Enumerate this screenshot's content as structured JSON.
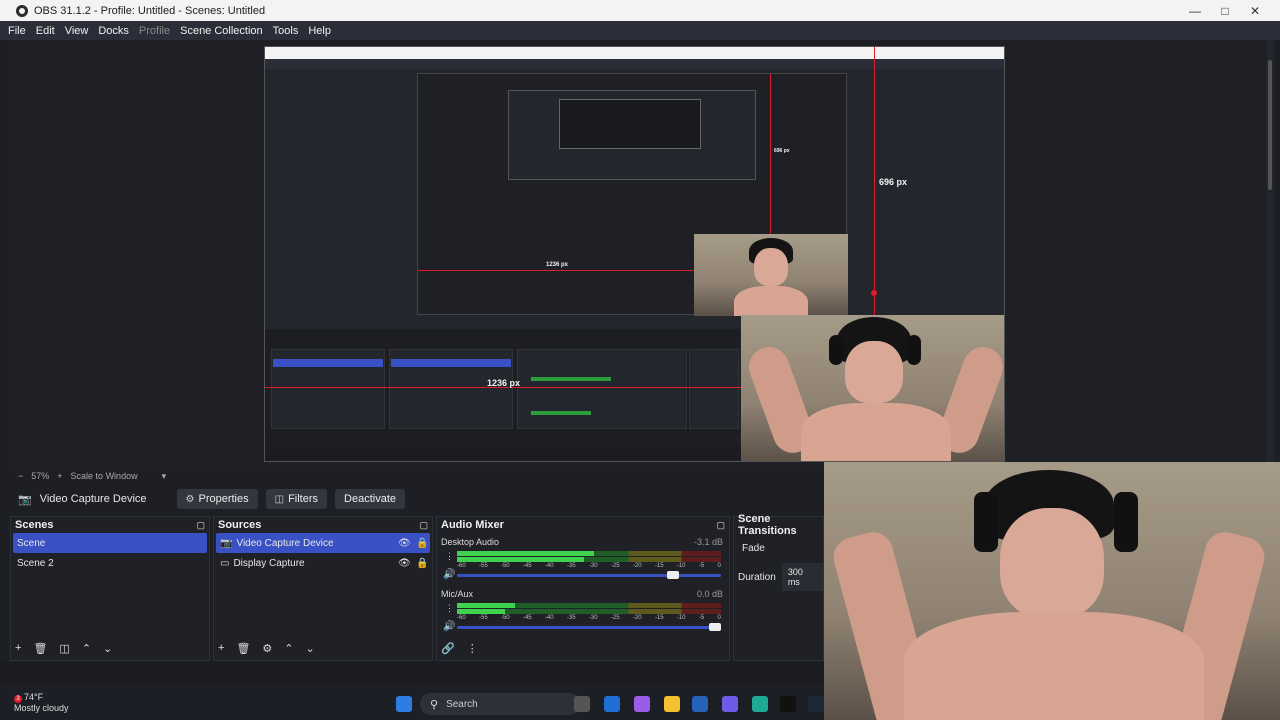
{
  "window": {
    "title": "OBS 31.1.2 - Profile: Untitled - Scenes: Untitled",
    "min_icon": "minimize-icon",
    "max_icon": "maximize-icon",
    "close_icon": "close-icon"
  },
  "menu": [
    "File",
    "Edit",
    "View",
    "Docks",
    "Profile",
    "Scene Collection",
    "Tools",
    "Help"
  ],
  "preview": {
    "measure_vertical": "696 px",
    "measure_horizontal": "1236 px",
    "nested_vertical": "696 px",
    "nested_horizontal": "1236 px"
  },
  "preview_controls": {
    "zoom_out": "−",
    "zoom": "57%",
    "zoom_in": "+",
    "scale_mode": "Scale to Window",
    "dropdown": "▾"
  },
  "source_toolbar": {
    "source": "Video Capture Device",
    "properties": "Properties",
    "filters": "Filters",
    "deactivate": "Deactivate"
  },
  "scenes": {
    "title": "Scenes",
    "items": [
      "Scene",
      "Scene 2"
    ],
    "selected_index": 0
  },
  "sources": {
    "title": "Sources",
    "items": [
      {
        "label": "Video Capture Device",
        "icon": "camera-icon"
      },
      {
        "label": "Display Capture",
        "icon": "monitor-icon"
      }
    ],
    "selected_index": 0
  },
  "audio_mixer": {
    "title": "Audio Mixer",
    "channels": [
      {
        "name": "Desktop Audio",
        "db": "-3.1 dB",
        "level": 0.52,
        "volume": 0.84
      },
      {
        "name": "Mic/Aux",
        "db": "0.0 dB",
        "level": 0.22,
        "volume": 1.0
      }
    ],
    "ticks": [
      "-60",
      "-55",
      "-50",
      "-45",
      "-40",
      "-35",
      "-30",
      "-25",
      "-20",
      "-15",
      "-10",
      "-5",
      "0"
    ]
  },
  "transitions": {
    "title": "Scene Transitions",
    "type": "Fade",
    "duration_label": "Duration",
    "duration_value": "300 ms"
  },
  "taskbar": {
    "temperature": "74°F",
    "condition": "Mostly cloudy",
    "badge": "3",
    "search_placeholder": "Search"
  },
  "colors": {
    "accent": "#3a51c5",
    "measure_red": "#e01b2a",
    "meter_green": "#3ed34f"
  }
}
